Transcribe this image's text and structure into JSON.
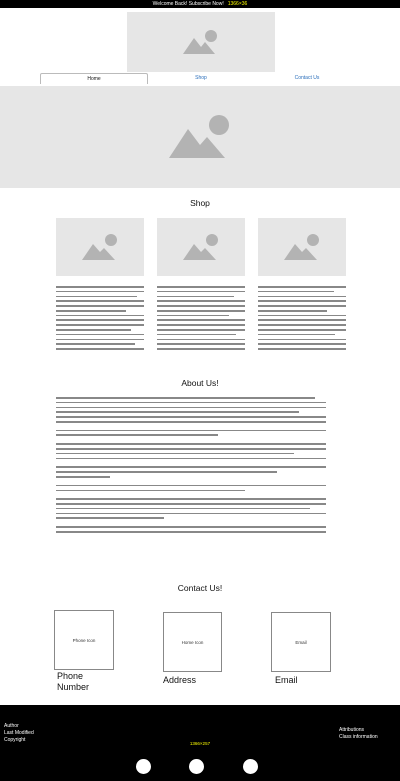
{
  "topbar": {
    "message": "Welcome Back! Subscribe Now!",
    "dimension": "1366×36"
  },
  "header": {
    "logo_image": "image-placeholder-icon"
  },
  "nav": {
    "tabs": [
      {
        "label": "Home"
      },
      {
        "label": "Shop"
      },
      {
        "label": "Contact Us"
      }
    ]
  },
  "hero": {
    "image": "image-placeholder-icon"
  },
  "shop": {
    "title": "Shop"
  },
  "about": {
    "title": "About Us!"
  },
  "contact": {
    "title": "Contact Us!",
    "items": [
      {
        "box_label": "Phone Icon",
        "label": "Phone Number"
      },
      {
        "box_label": "Home Icon",
        "label": "Address"
      },
      {
        "box_label": "Email",
        "label": "Email"
      }
    ]
  },
  "footer": {
    "left_lines": [
      "Author",
      "Last Modified",
      "Copyright"
    ],
    "right_lines": [
      "Attributions",
      "Class information"
    ],
    "dimension": "1366×257"
  },
  "colors": {
    "topbar_bg": "#000000",
    "footer_bg": "#000000",
    "link": "#2a6ebb",
    "dimension_text": "#ffff00",
    "placeholder": "#e6e6e6"
  }
}
